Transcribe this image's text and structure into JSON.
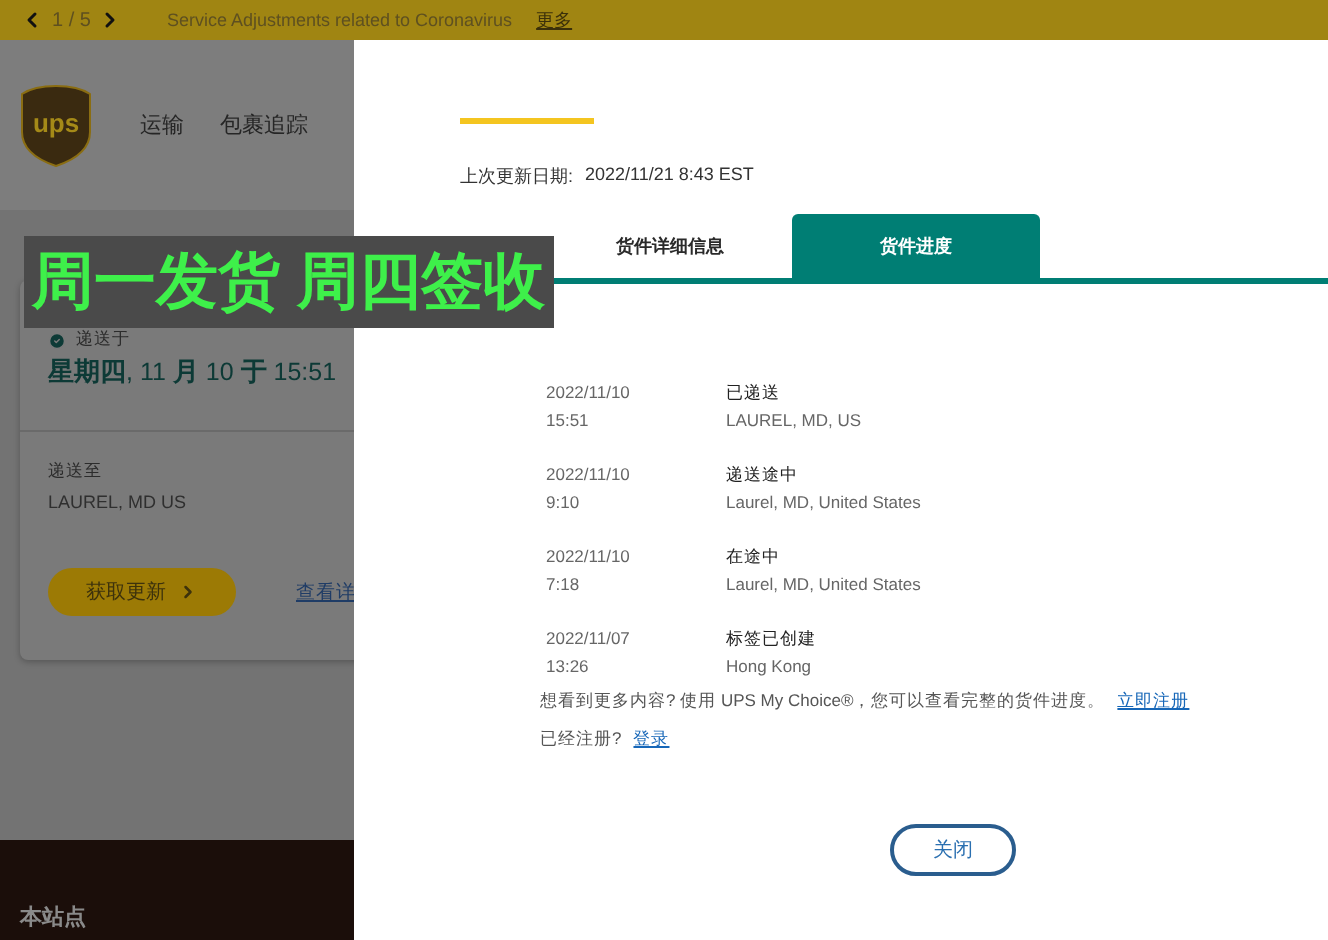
{
  "announcement": {
    "pager": "1 / 5",
    "text": "Service Adjustments related to Coronavirus",
    "link": "更多"
  },
  "header": {
    "logo_text": "ups",
    "nav": [
      "运输",
      "包裹追踪"
    ]
  },
  "card": {
    "status": "递送于",
    "delivered_date": "**星期四**, 11 **月** 10 **于** 15:51",
    "ship_to_label": "递送至",
    "ship_to": "LAUREL, MD US",
    "update_button": "获取更新",
    "details_link": "查看详"
  },
  "footer": {
    "title": "本站点"
  },
  "overlay_caption": "周一发货 周四签收",
  "modal": {
    "last_updated_label": "上次更新日期:",
    "last_updated": "2022/11/21 8:43 EST",
    "tabs": [
      {
        "label": "货件详细信息",
        "selected": false
      },
      {
        "label": "货件进度",
        "selected": true
      }
    ],
    "events": [
      {
        "date": "2022/11/10",
        "time": "15:51",
        "status": "已递送",
        "location": "LAUREL, MD, US"
      },
      {
        "date": "2022/11/10",
        "time": "9:10",
        "status": "递送途中",
        "location": "Laurel, MD, United States"
      },
      {
        "date": "2022/11/10",
        "time": "7:18",
        "status": "在途中",
        "location": "Laurel, MD, United States"
      },
      {
        "date": "2022/11/07",
        "time": "13:26",
        "status": "标签已创建",
        "location": "Hong Kong"
      }
    ],
    "promo": {
      "text": "想看到更多内容? 使用 UPS My Choice®，您可以查看完整的货件进度。",
      "link": "立即注册"
    },
    "login": {
      "text": "已经注册?",
      "link": "登录"
    },
    "close_button": "关闭"
  }
}
